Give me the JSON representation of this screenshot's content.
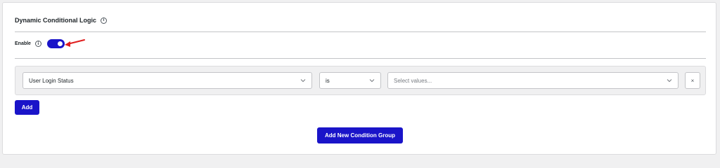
{
  "section": {
    "title": "Dynamic Conditional Logic",
    "info_icon": "info-icon"
  },
  "enable": {
    "label": "Enable",
    "info_icon": "info-icon",
    "toggle_on": true,
    "annotation_arrow_color": "#e01e1e"
  },
  "condition_group": {
    "field_select": {
      "value": "User Login Status"
    },
    "operator_select": {
      "value": "is"
    },
    "values_select": {
      "placeholder": "Select values..."
    },
    "remove_label": "×"
  },
  "buttons": {
    "add_label": "Add",
    "add_group_label": "Add New Condition Group"
  },
  "colors": {
    "accent": "#1a14c9",
    "arrow": "#e01e1e"
  }
}
